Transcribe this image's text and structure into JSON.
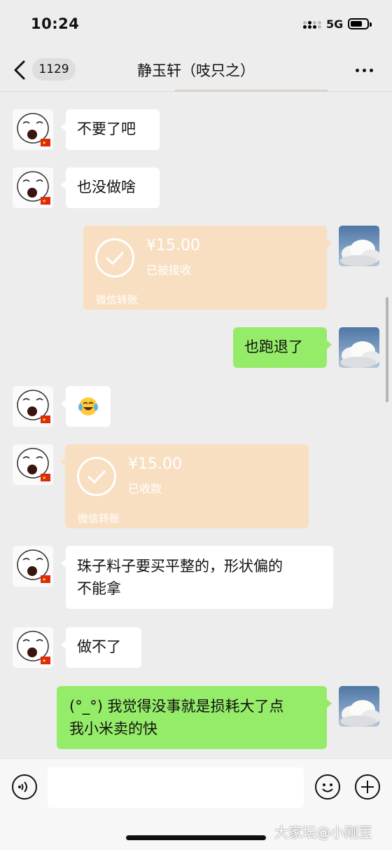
{
  "status_bar": {
    "time": "10:24",
    "network": "5G"
  },
  "header": {
    "unread_count": "1129",
    "title": "静玉轩（吱只之）"
  },
  "messages": [
    {
      "side": "left",
      "type": "text",
      "text": "不要了吧"
    },
    {
      "side": "left",
      "type": "text",
      "text": "也没做啥"
    },
    {
      "side": "right",
      "type": "transfer",
      "amount": "¥15.00",
      "status": "已被接收",
      "label": "微信转账"
    },
    {
      "side": "right",
      "type": "text",
      "text": "也跑退了"
    },
    {
      "side": "left",
      "type": "emoji",
      "text": "😂"
    },
    {
      "side": "left",
      "type": "transfer",
      "amount": "¥15.00",
      "status": "已收款",
      "label": "微信转账"
    },
    {
      "side": "left",
      "type": "text",
      "lines": [
        "珠子料子要买平整的，形状偏的",
        "不能拿"
      ]
    },
    {
      "side": "left",
      "type": "text",
      "text": "做不了"
    },
    {
      "side": "right",
      "type": "text",
      "lines": [
        "(°_°) 我觉得没事就是损耗大了点",
        "我小米卖的快"
      ]
    }
  ],
  "watermark": "大家坛@小刚豆",
  "colors": {
    "background": "#ededed",
    "bubble_self": "#95ec69",
    "bubble_other": "#ffffff",
    "transfer": "#f8dfc2"
  }
}
